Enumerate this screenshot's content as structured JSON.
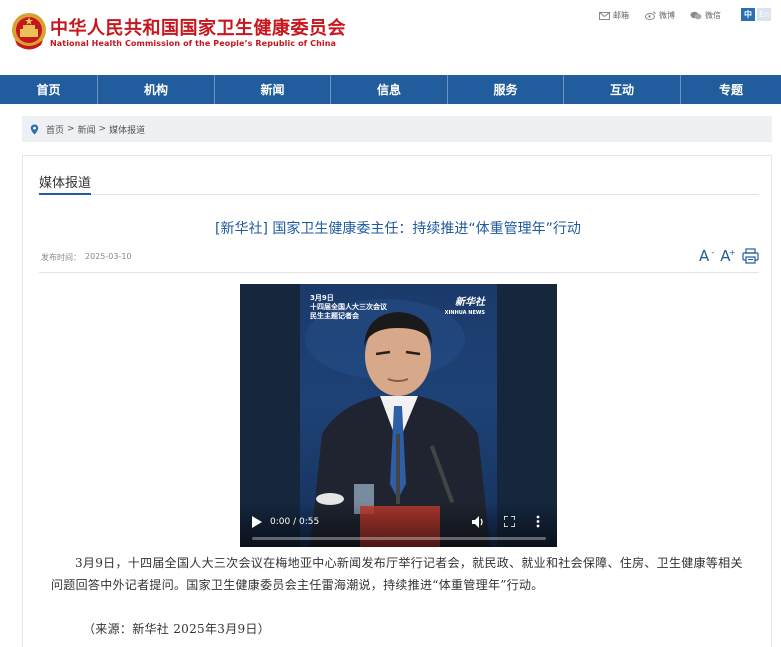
{
  "header": {
    "title_cn": "中华人民共和国国家卫生健康委员会",
    "title_en": "National Health Commission of the People’s Republic of China",
    "links": [
      {
        "label": "邮箱",
        "icon": "mail-icon"
      },
      {
        "label": "微博",
        "icon": "weibo-icon"
      },
      {
        "label": "微信",
        "icon": "wechat-icon"
      }
    ],
    "lang_cn": "中",
    "lang_en": "En"
  },
  "nav": {
    "items": [
      "首页",
      "机构",
      "新闻",
      "信息",
      "服务",
      "互动",
      "专题"
    ]
  },
  "breadcrumb": {
    "home": "首页",
    "sep1": ">",
    "news": "新闻",
    "sep2": ">",
    "current": "媒体报道"
  },
  "section": {
    "title": "媒体报道"
  },
  "article": {
    "title": "[新华社] 国家卫生健康委主任：持续推进“体重管理年”行动",
    "publish_label": "发布时间：",
    "publish_date": "2025-03-10",
    "font_increase": "A",
    "font_decrease": "A",
    "body": "3月9日，十四届全国人大三次会议在梅地亚中心新闻发布厅举行记者会，就民政、就业和社会保障、住房、卫生健康等相关问题回答中外记者提问。国家卫生健康委员会主任雷海潮说，持续推进“体重管理年”行动。",
    "source": "（来源：新华社 2025年3月9日）"
  },
  "video": {
    "caption_line1": "3月9日",
    "caption_line2": "十四届全国人大三次会议",
    "caption_line3": "民生主题记者会",
    "logo": "新华社",
    "logo_en": "XINHUA NEWS",
    "time": "0:00 / 0:55",
    "progress": 0.0
  },
  "colors": {
    "brand_red": "#c8161d",
    "nav_blue": "#215c9c",
    "title_blue": "#1f5aa0"
  }
}
